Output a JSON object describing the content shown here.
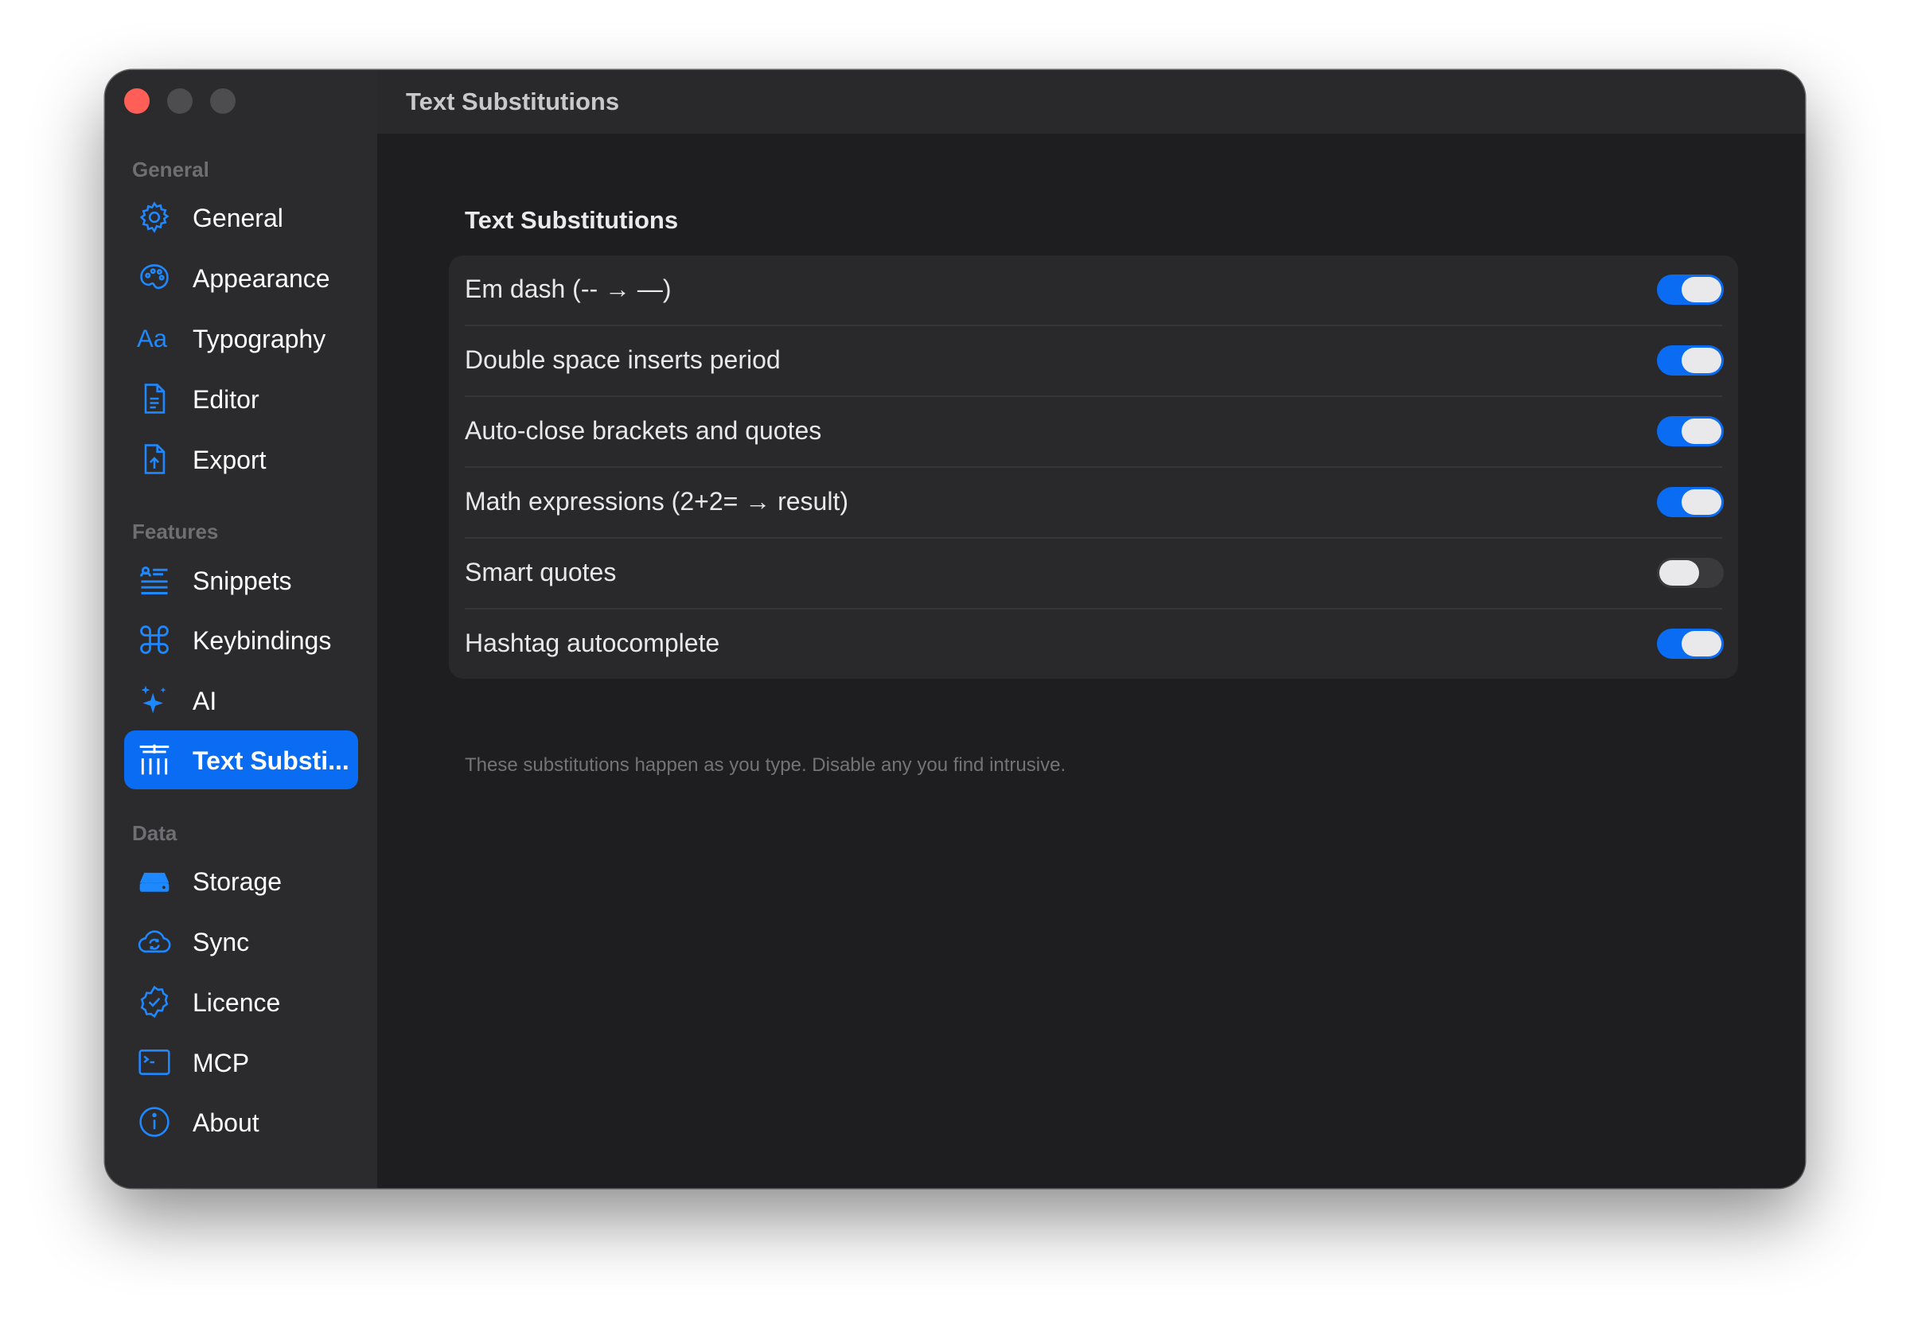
{
  "window": {
    "title": "Text Substitutions"
  },
  "sidebar": {
    "sections": [
      {
        "header": "General",
        "items": [
          {
            "label": "General",
            "icon": "gear-icon"
          },
          {
            "label": "Appearance",
            "icon": "palette-icon"
          },
          {
            "label": "Typography",
            "icon": "textformat-icon"
          },
          {
            "label": "Editor",
            "icon": "document-icon"
          },
          {
            "label": "Export",
            "icon": "document-upload-icon"
          }
        ]
      },
      {
        "header": "Features",
        "items": [
          {
            "label": "Snippets",
            "icon": "list-icon"
          },
          {
            "label": "Keybindings",
            "icon": "command-icon"
          },
          {
            "label": "AI",
            "icon": "sparkles-icon"
          },
          {
            "label": "Text Substi...",
            "icon": "text-substitution-icon",
            "selected": true
          }
        ]
      },
      {
        "header": "Data",
        "items": [
          {
            "label": "Storage",
            "icon": "drive-icon"
          },
          {
            "label": "Sync",
            "icon": "cloud-sync-icon"
          },
          {
            "label": "Licence",
            "icon": "checkmark-seal-icon"
          },
          {
            "label": "MCP",
            "icon": "terminal-icon"
          },
          {
            "label": "About",
            "icon": "info-icon"
          }
        ]
      }
    ]
  },
  "main": {
    "title": "Text Substitutions",
    "settings": [
      {
        "label": "Em dash (-- → —)",
        "enabled": true
      },
      {
        "label": "Double space inserts period",
        "enabled": true
      },
      {
        "label": "Auto-close brackets and quotes",
        "enabled": true
      },
      {
        "label": "Math expressions (2+2= → result)",
        "enabled": true
      },
      {
        "label": "Smart quotes",
        "enabled": false
      },
      {
        "label": "Hashtag autocomplete",
        "enabled": true
      }
    ],
    "footnote": "These substitutions happen as you type. Disable any you find intrusive."
  },
  "colors": {
    "accent": "#0a6cf2",
    "close": "#ff5f57",
    "sidebar_bg": "#2b2b2e",
    "content_bg": "#1e1e20"
  }
}
